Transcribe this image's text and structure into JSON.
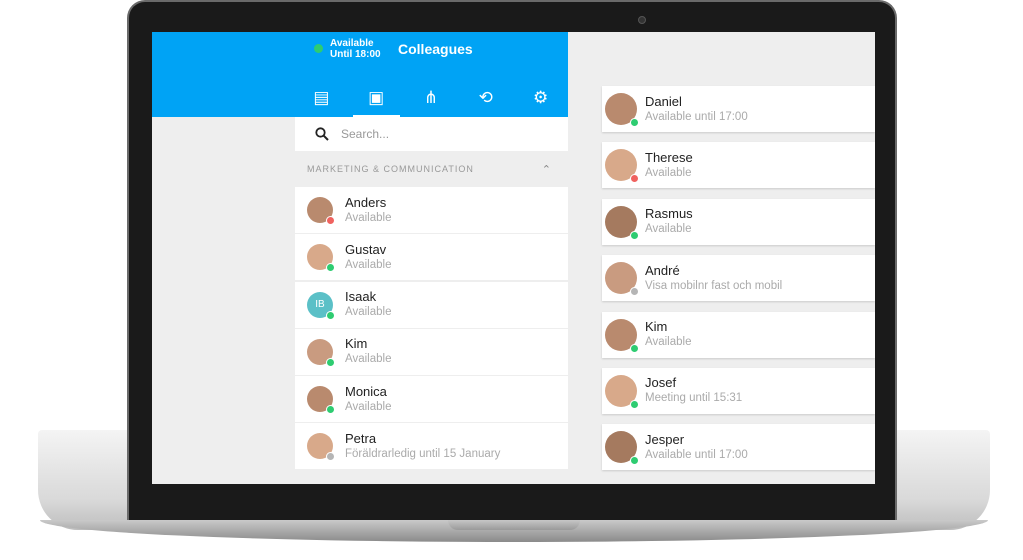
{
  "colors": {
    "brand": "#00a3f5",
    "available": "#2ecc71",
    "busy": "#f0625f",
    "offline": "#b5b5b5"
  },
  "header": {
    "status_line1": "Available",
    "status_line2": "Until 18:00",
    "title": "Colleagues",
    "tabs": [
      {
        "icon": "chat-icon",
        "glyph": "▤"
      },
      {
        "icon": "contacts-icon",
        "glyph": "▣"
      },
      {
        "icon": "org-chart-icon",
        "glyph": "⋔"
      },
      {
        "icon": "history-icon",
        "glyph": "⟲"
      },
      {
        "icon": "gear-icon",
        "glyph": "⚙"
      }
    ]
  },
  "search": {
    "placeholder": "Search..."
  },
  "section": {
    "label": "MARKETING & COMMUNICATION"
  },
  "contacts": [
    {
      "name": "Anders",
      "status": "Available",
      "presence": "busy"
    },
    {
      "name": "Gustav",
      "status": "Available",
      "presence": "available"
    },
    {
      "name": "Isaak",
      "status": "Available",
      "presence": "available",
      "initials": "IB"
    },
    {
      "name": "Kim",
      "status": "Available",
      "presence": "available"
    },
    {
      "name": "Monica",
      "status": "Available",
      "presence": "available"
    },
    {
      "name": "Petra",
      "status": "Föräldrarledig until 15 January",
      "presence": "offline"
    }
  ],
  "favorites": [
    {
      "name": "Daniel",
      "status": "Available until 17:00",
      "presence": "available"
    },
    {
      "name": "Therese",
      "status": "Available",
      "presence": "busy"
    },
    {
      "name": "Rasmus",
      "status": "Available",
      "presence": "available"
    },
    {
      "name": "André",
      "status": "Visa mobilnr fast och mobil",
      "presence": "offline"
    },
    {
      "name": "Kim",
      "status": "Available",
      "presence": "available"
    },
    {
      "name": "Josef",
      "status": "Meeting until 15:31",
      "presence": "available"
    },
    {
      "name": "Jesper",
      "status": "Available until 17:00",
      "presence": "available"
    }
  ]
}
